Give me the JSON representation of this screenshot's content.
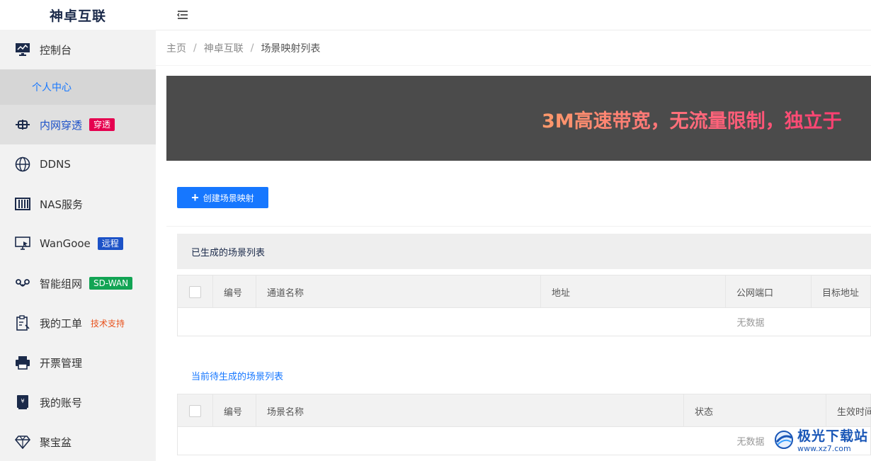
{
  "brand": {
    "title": "神卓互联"
  },
  "sidebar": {
    "items": [
      {
        "label": "控制台",
        "icon": "dashboard-icon"
      },
      {
        "label": "个人中心",
        "sub": true
      },
      {
        "label": "内网穿透",
        "icon": "tunnel-icon",
        "badge": "穿透",
        "active": true
      },
      {
        "label": "DDNS",
        "icon": "globe-icon"
      },
      {
        "label": "NAS服务",
        "icon": "nas-icon"
      },
      {
        "label": "WanGooe",
        "icon": "monitor-icon",
        "badge": "远程"
      },
      {
        "label": "智能组网",
        "icon": "network-icon",
        "badge": "SD-WAN"
      },
      {
        "label": "我的工单",
        "icon": "ticket-icon",
        "badge_text": "技术支持"
      },
      {
        "label": "开票管理",
        "icon": "printer-icon"
      },
      {
        "label": "我的账号",
        "icon": "account-icon"
      },
      {
        "label": "聚宝盆",
        "icon": "diamond-icon"
      }
    ]
  },
  "breadcrumb": {
    "home": "主页",
    "level1": "神卓互联",
    "current": "场景映射列表",
    "sep": "/"
  },
  "banner": {
    "text": "3M高速带宽，无流量限制，独立于"
  },
  "create_button": {
    "label": "创建场景映射"
  },
  "section1": {
    "title": "已生成的场景列表",
    "columns": [
      "编号",
      "通道名称",
      "地址",
      "公网端口",
      "目标地址"
    ],
    "empty": "无数据"
  },
  "section2": {
    "title": "当前待生成的场景列表",
    "columns": [
      "编号",
      "场景名称",
      "状态",
      "生效时间"
    ],
    "empty": "无数据"
  },
  "watermark": {
    "title": "极光下载站",
    "url": "www.xz7.com"
  },
  "colors": {
    "primary": "#1677ff",
    "sidebar_bg": "#f2f2f2",
    "banner_bg": "#4b4b4b",
    "badge_pink": "#e5004f",
    "badge_blue": "#1c52c7",
    "badge_green": "#12a454"
  }
}
